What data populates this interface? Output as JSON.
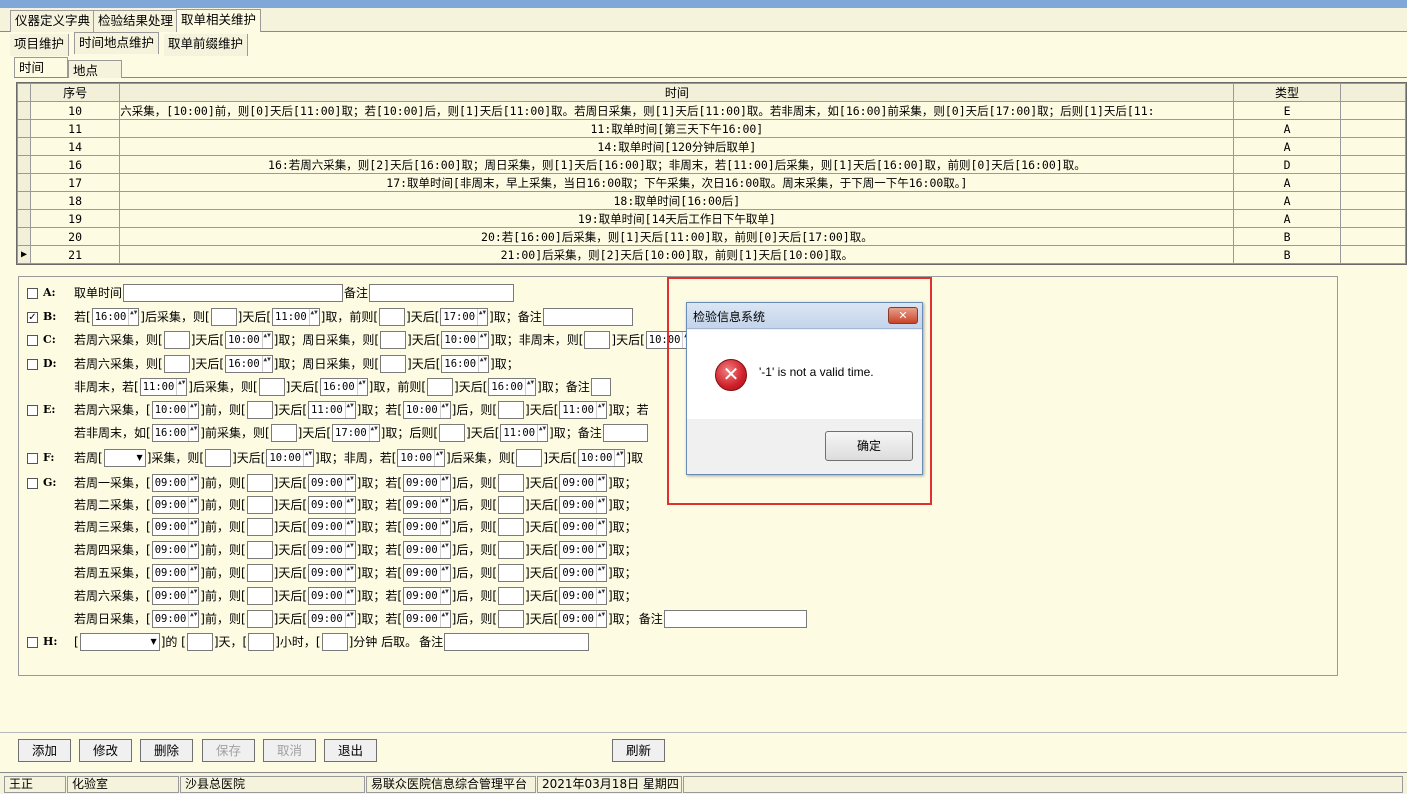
{
  "main_tabs": [
    "仪器定义字典",
    "检验结果处理",
    "取单相关维护"
  ],
  "sub_tabs": [
    "项目维护",
    "时间地点维护",
    "取单前缀维护"
  ],
  "inner_tabs": [
    "时间",
    "地点"
  ],
  "grid": {
    "headers": [
      "序号",
      "时间",
      "类型"
    ],
    "rows": [
      {
        "no": "10",
        "time": "六采集，[10:00]前，则[0]天后[11:00]取；若[10:00]后，则[1]天后[11:00]取。若周日采集，则[1]天后[11:00]取。若非周末，如[16:00]前采集，则[0]天后[17:00]取；后则[1]天后[11:",
        "type": "E"
      },
      {
        "no": "11",
        "time": "11:取单时间[第三天下午16:00]",
        "type": "A"
      },
      {
        "no": "14",
        "time": "14:取单时间[120分钟后取单]",
        "type": "A"
      },
      {
        "no": "16",
        "time": "16:若周六采集，则[2]天后[16:00]取；周日采集，则[1]天后[16:00]取；非周末，若[11:00]后采集，则[1]天后[16:00]取，前则[0]天后[16:00]取。",
        "type": "D"
      },
      {
        "no": "17",
        "time": "17:取单时间[非周末，早上采集，当日16:00取；下午采集，次日16:00取。周末采集，于下周一下午16:00取。]",
        "type": "A"
      },
      {
        "no": "18",
        "time": "18:取单时间[16:00后]",
        "type": "A"
      },
      {
        "no": "19",
        "time": "19:取单时间[14天后工作日下午取单]",
        "type": "A"
      },
      {
        "no": "20",
        "time": "20:若[16:00]后采集，则[1]天后[11:00]取，前则[0]天后[17:00]取。",
        "type": "B"
      },
      {
        "no": "21",
        "time": "21:00]后采集，则[2]天后[10:00]取，前则[1]天后[10:00]取。",
        "type": "B"
      }
    ]
  },
  "form": {
    "a": {
      "label": "A:",
      "t1": "取单时间",
      "t2": "备注"
    },
    "b": {
      "label": "B:",
      "t1": "若[",
      "v1": "16:00",
      "t2": "]后采集，则[",
      "t3": "]天后[",
      "v2": "11:00",
      "t4": "]取，前则[",
      "t5": "]天后[",
      "v3": "17:00",
      "t6": "]取；备注"
    },
    "c": {
      "label": "C:",
      "t1": "若周六采集，则[",
      "t2": "]天后[",
      "v1": "10:00",
      "t3": "]取；周日采集，则[",
      "t4": "]天后[",
      "v2": "10:00",
      "t5": "]取；非周末，则[",
      "t6": "]天后[",
      "v3": "10:00",
      "t7": "]取；"
    },
    "d": {
      "label": "D:",
      "t1": "若周六采集，则[",
      "t2": "]天后[",
      "v1": "16:00",
      "t3": "]取；周日采集，则[",
      "t4": "]天后[",
      "v2": "16:00",
      "t5": "]取；",
      "t6": "非周末，若[",
      "v3": "11:00",
      "t7": "]后采集，则[",
      "t8": "]天后[",
      "v4": "16:00",
      "t9": "]取，前则[",
      "t10": "]天后[",
      "v5": "16:00",
      "t11": "]取；备注"
    },
    "e": {
      "label": "E:",
      "t1": "若周六采集，[",
      "v1": "10:00",
      "t2": "]前，则[",
      "t3": "]天后[",
      "v2": "11:00",
      "t4": "]取；若[",
      "v3": "10:00",
      "t5": "]后，则[",
      "t6": "]天后[",
      "v4": "11:00",
      "t7": "]取；若",
      "t8": "若非周末，如[",
      "v5": "16:00",
      "t9": "]前采集，则[",
      "t10": "]天后[",
      "v6": "17:00",
      "t11": "]取；后则[",
      "t12": "]天后[",
      "v7": "11:00",
      "t13": "]取；备注"
    },
    "f": {
      "label": "F:",
      "t1": "若周[",
      "t2": "]采集，则[",
      "t3": "]天后[",
      "v1": "10:00",
      "t4": "]取；非周，若[",
      "v2": "10:00",
      "t5": "]后采集，则[",
      "t6": "]天后[",
      "v3": "10:00",
      "t7": "]取"
    },
    "g": {
      "label": "G:",
      "days": [
        "若周一采集，[",
        "若周二采集，[",
        "若周三采集，[",
        "若周四采集，[",
        "若周五采集，[",
        "若周六采集，[",
        "若周日采集，["
      ],
      "v": "09:00",
      "t_front": "]前，则[",
      "t_days": "]天后[",
      "t_if": "]取；若[",
      "t_after": "]后，则[",
      "t_end": "]取；",
      "t_remark": "备注"
    },
    "h": {
      "label": "H:",
      "t1": "[",
      "t2": "]的 [",
      "t3": "]天，[",
      "t4": "]小时，[",
      "t5": "]分钟 后取。",
      "t6": "备注"
    }
  },
  "buttons": {
    "add": "添加",
    "edit": "修改",
    "delete": "删除",
    "save": "保存",
    "cancel": "取消",
    "exit": "退出",
    "refresh": "刷新"
  },
  "status": [
    "王正",
    "化验室",
    "沙县总医院",
    "易联众医院信息综合管理平台",
    "2021年03月18日 星期四"
  ],
  "dialog": {
    "title": "检验信息系统",
    "message": "'-1' is not a valid time.",
    "ok": "确定",
    "close": "✕",
    "icon": "error-icon"
  },
  "colors": {
    "background": "#fdfbe2",
    "highlight_box": "#e03030",
    "title_bar": "#7fa8d8"
  }
}
